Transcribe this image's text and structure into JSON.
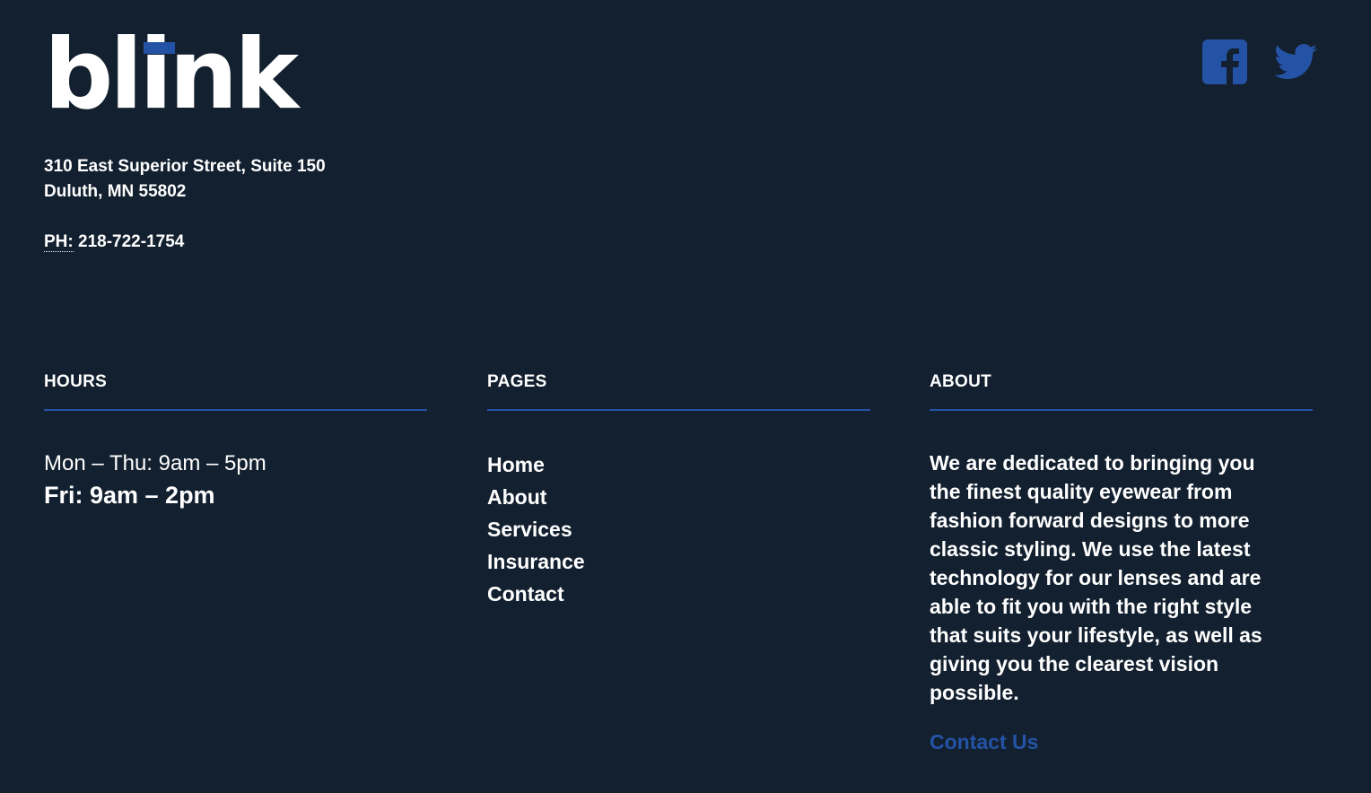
{
  "brand": {
    "name": "blink",
    "accent": "#2453a6",
    "background": "#13202f"
  },
  "social": [
    {
      "icon": "facebook-icon",
      "label": "Facebook"
    },
    {
      "icon": "twitter-icon",
      "label": "Twitter"
    }
  ],
  "address": {
    "line1": "310 East Superior Street, Suite 150",
    "line2": "Duluth, MN 55802",
    "phone_label": "PH:",
    "phone": "218-722-1754"
  },
  "hours": {
    "title": "HOURS",
    "weekdays": "Mon – Thu: 9am – 5pm",
    "friday": "Fri: 9am – 2pm"
  },
  "pages": {
    "title": "PAGES",
    "items": [
      "Home",
      "About",
      "Services",
      "Insurance",
      "Contact"
    ]
  },
  "about": {
    "title": "ABOUT",
    "text": "We are dedicated to bringing you the finest quality eyewear from fashion forward designs to more classic styling. We use the latest technology for our lenses and are able to fit you with the right style that suits your lifestyle, as well as giving you the clearest vision possible.",
    "link": "Contact Us"
  }
}
